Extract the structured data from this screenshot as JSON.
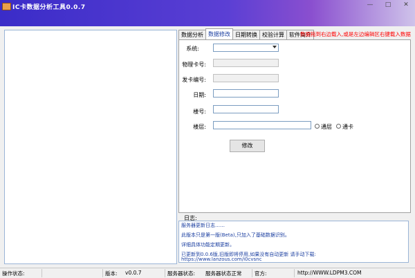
{
  "window": {
    "title": "IC卡数据分析工具0.0.7",
    "minimize": "—",
    "maximize": "□",
    "close": "✕"
  },
  "tabs": [
    {
      "label": "数据分析"
    },
    {
      "label": "数据修改"
    },
    {
      "label": "日期转换"
    },
    {
      "label": "校验计算"
    },
    {
      "label": "软件简介"
    }
  ],
  "tab_hint": "数据拖到右边载入,或是左边编辑区右键载入数据",
  "form": {
    "system_label": "系统:",
    "system_value": "",
    "physical_card_label": "物理卡号:",
    "issue_card_label": "发卡编号:",
    "date_label": "日期:",
    "building_label": "楼号:",
    "floor_label": "楼层:",
    "radio_floor": "通层",
    "radio_pass": "通卡",
    "modify_button": "修改"
  },
  "log": {
    "label": "日志:",
    "lines": [
      "服务器更新日志……",
      "此版本只是第一版(Beta),只加入了基础数据识别。",
      "详细具体功能定期更新。",
      "已更新到0.0.6版,旧版即将停用,如果没有自动更新 请手动下载:",
      "https://www.lanzous.com/i0cvsnc"
    ]
  },
  "status": {
    "op_label": "操作状态:",
    "version_label": "版本:",
    "version_value": "v0.0.7",
    "server_label": "服务器状态:",
    "server_value": "服务器状态正常",
    "official_label": "官方:",
    "official_value": "http://WWW.LDPM3.COM"
  }
}
